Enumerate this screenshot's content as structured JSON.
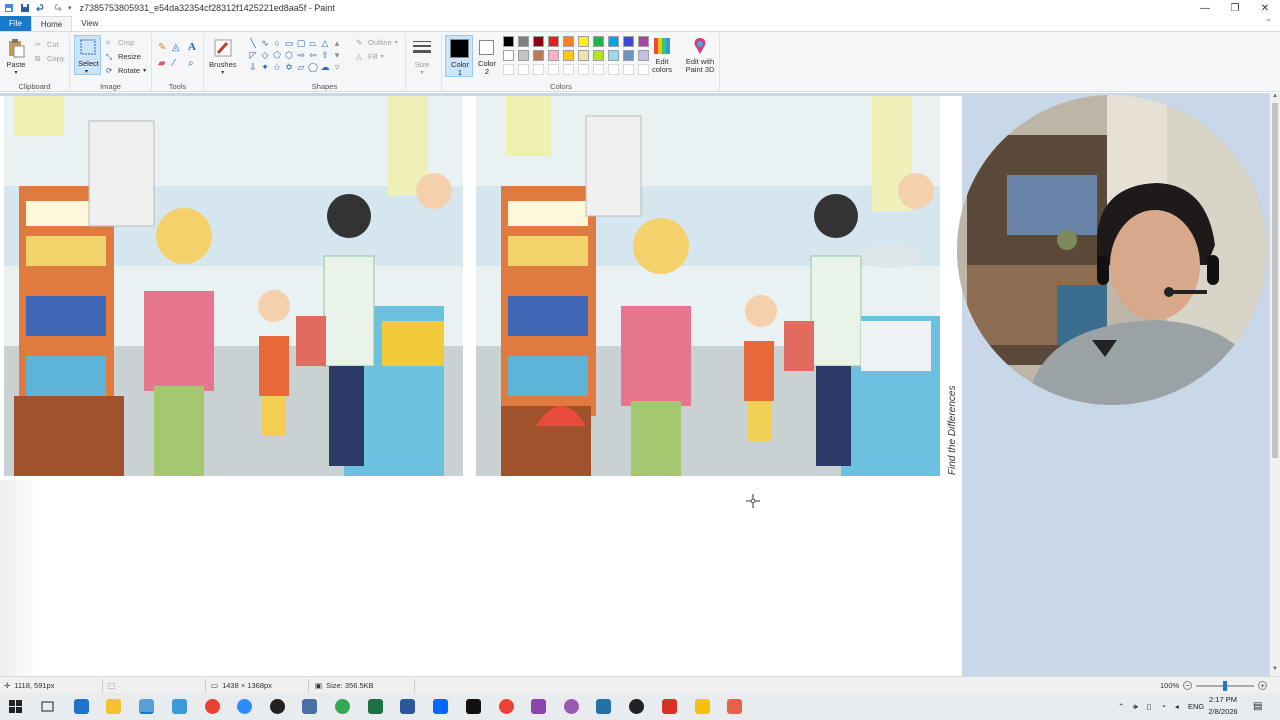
{
  "window": {
    "title": "z7385753805931_e54da32354cf28312f1425221ed8aa5f - Paint",
    "minimize": "—",
    "maximize": "❐",
    "close": "✕"
  },
  "menu": {
    "tabs": [
      "File",
      "Home",
      "View"
    ]
  },
  "ribbon": {
    "clipboard": {
      "paste": "Paste",
      "cut": "Cut",
      "copy": "Copy",
      "label": "Clipboard"
    },
    "image": {
      "select": "Select",
      "crop": "Crop",
      "resize": "Resize",
      "rotate": "Rotate",
      "label": "Image"
    },
    "tools": {
      "label": "Tools"
    },
    "brushes": {
      "label": "Brushes"
    },
    "shapes": {
      "outline": "Outline",
      "fill": "Fill",
      "label": "Shapes"
    },
    "size": {
      "label": "Size"
    },
    "colors": {
      "color1": "Color 1",
      "color2": "Color 2",
      "edit_colors": "Edit colors",
      "label": "Colors",
      "palette_row1": [
        "#000000",
        "#7f7f7f",
        "#880015",
        "#ed1c24",
        "#ff7f27",
        "#fff200",
        "#22b14c",
        "#00a2e8",
        "#3f48cc",
        "#a349a4"
      ],
      "palette_row2": [
        "#ffffff",
        "#c3c3c3",
        "#b97a57",
        "#ffaec9",
        "#ffc90e",
        "#efe4b0",
        "#b5e61d",
        "#99d9ea",
        "#7092be",
        "#c8bfe7"
      ]
    },
    "paint3d": {
      "label": "Edit with Paint 3D"
    }
  },
  "canvas": {
    "side_caption": "Find the Differences"
  },
  "status": {
    "cursor_pos": "1118, 591px",
    "dimensions": "1438 × 1368px",
    "size": "Size: 356.5KB",
    "zoom": "100%"
  },
  "taskbar": {
    "language": "ENG",
    "time": "2:17 PM",
    "date": "2/8/2026"
  }
}
